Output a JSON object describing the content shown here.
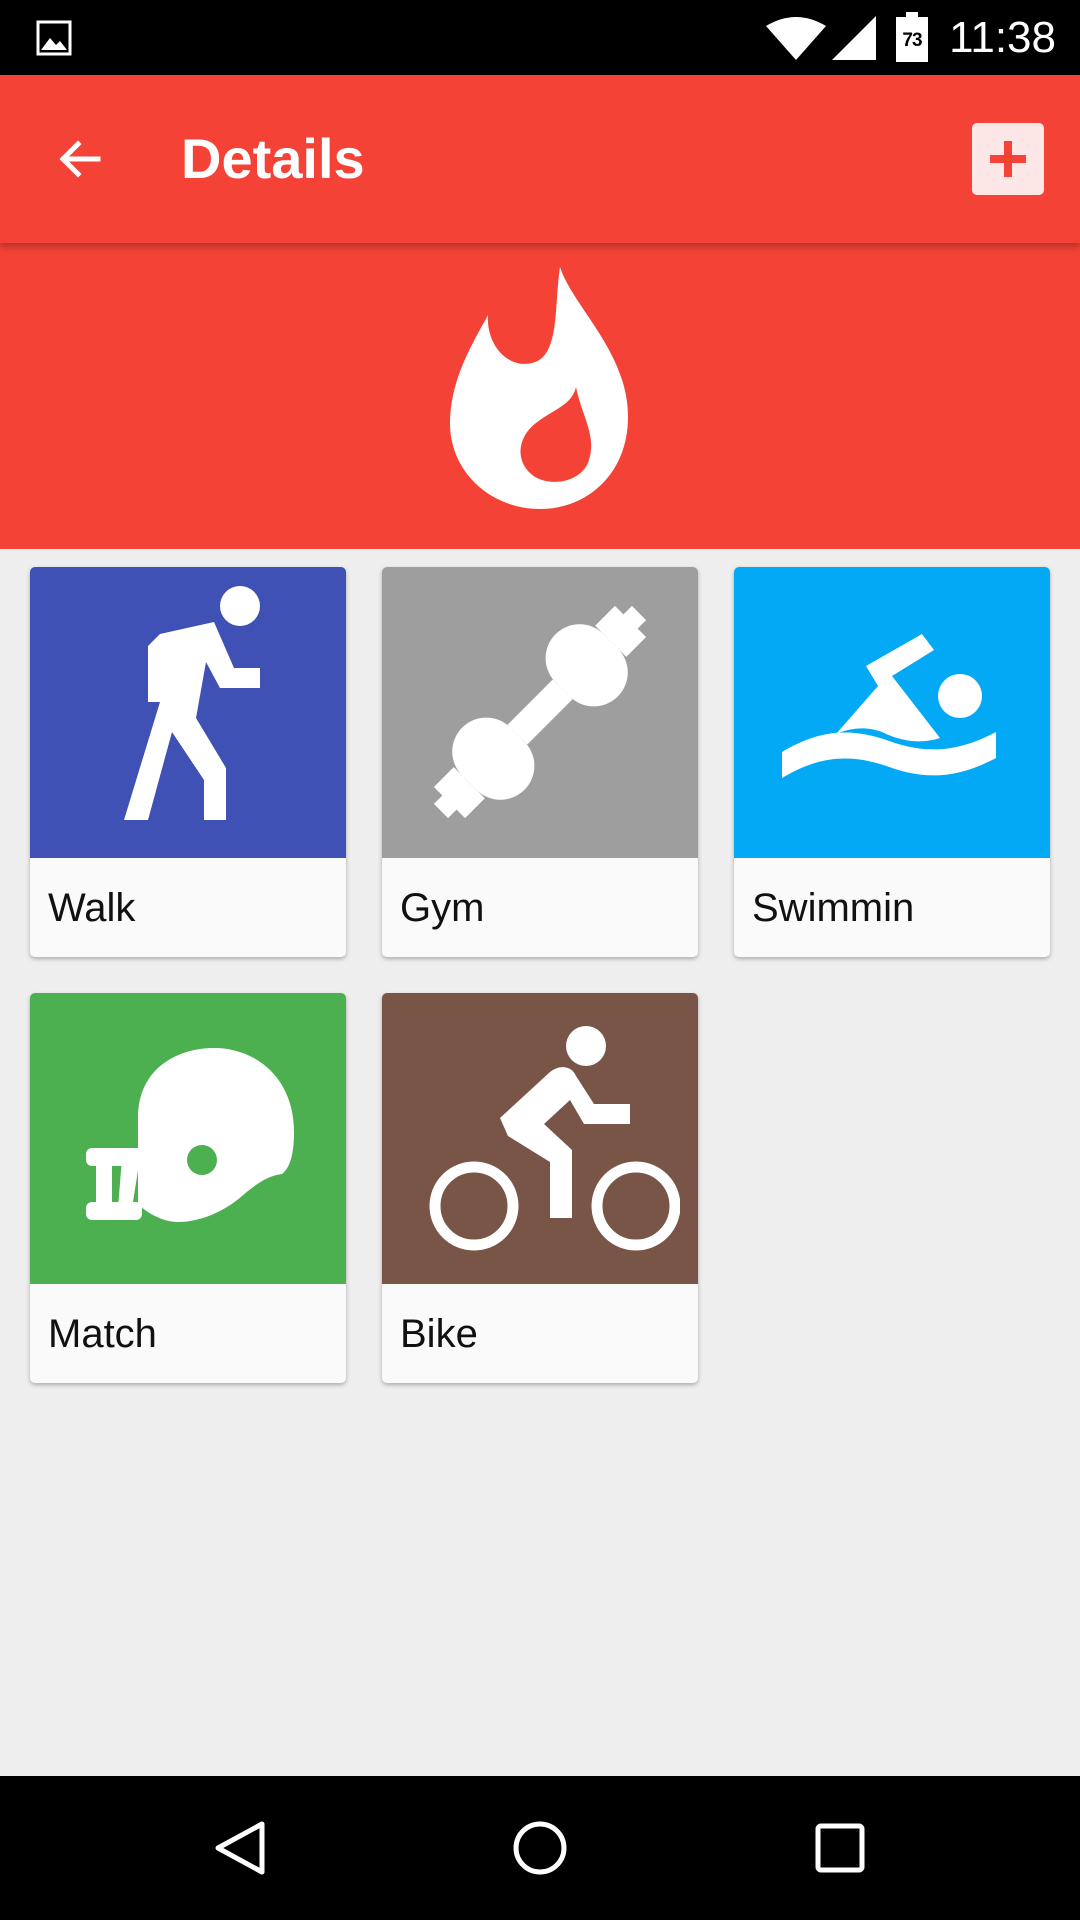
{
  "status_bar": {
    "notification_icon": "image-icon",
    "wifi_icon": "wifi-icon",
    "signal_icon": "cell-signal-icon",
    "battery_icon": "battery-icon",
    "battery_level": "73",
    "time": "11:38"
  },
  "app_bar": {
    "back_icon": "arrow-back-icon",
    "title": "Details",
    "add_icon": "add-box-icon",
    "background_color": "#f44336"
  },
  "hero": {
    "icon": "flame-icon",
    "background_color": "#f44336"
  },
  "activities": [
    {
      "label": "Walk",
      "icon": "walk-icon",
      "color": "#3f51b5"
    },
    {
      "label": "Gym",
      "icon": "dumbbell-icon",
      "color": "#9e9e9e"
    },
    {
      "label": "Swimmin",
      "icon": "swimmer-icon",
      "color": "#03a9f4"
    },
    {
      "label": "Match",
      "icon": "football-helmet-icon",
      "color": "#4caf50"
    },
    {
      "label": "Bike",
      "icon": "cyclist-icon",
      "color": "#795548"
    }
  ],
  "nav_bar": {
    "back_icon": "nav-back-icon",
    "home_icon": "nav-home-icon",
    "recents_icon": "nav-recents-icon"
  }
}
